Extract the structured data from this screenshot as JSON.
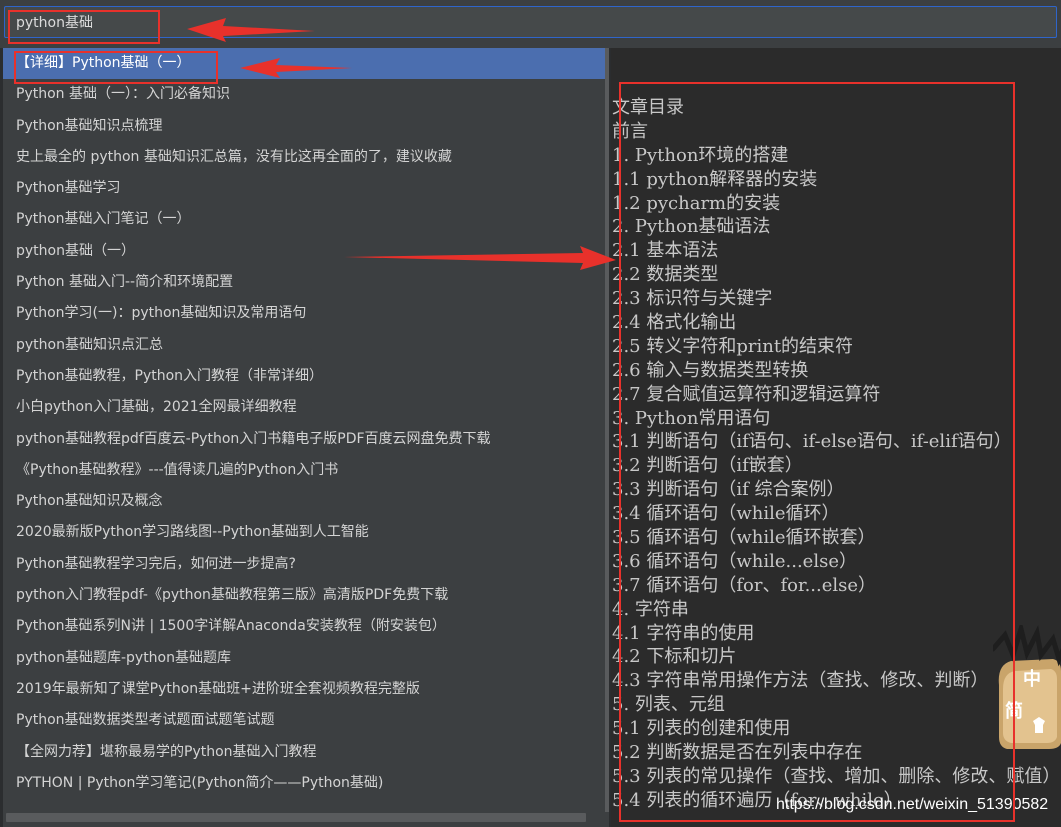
{
  "search": {
    "value": "python基础"
  },
  "results": [
    "【详细】Python基础（一）",
    "Python 基础（一）：入门必备知识",
    "Python基础知识点梳理",
    "史上最全的 python 基础知识汇总篇，没有比这再全面的了，建议收藏",
    "Python基础学习",
    "Python基础入门笔记（一）",
    "python基础（一）",
    "Python 基础入门--简介和环境配置",
    "Python学习(一)：python基础知识及常用语句",
    "python基础知识点汇总",
    "Python基础教程，Python入门教程（非常详细）",
    "小白python入门基础，2021全网最详细教程",
    "python基础教程pdf百度云-Python入门书籍电子版PDF百度云网盘免费下载",
    "《Python基础教程》---值得读几遍的Python入门书",
    "Python基础知识及概念",
    "2020最新版Python学习路线图--Python基础到人工智能",
    "Python基础教程学习完后，如何进一步提高?",
    "python入门教程pdf-《python基础教程第三版》高清版PDF免费下载",
    "Python基础系列N讲 | 1500字详解Anaconda安装教程（附安装包）",
    "python基础题库-python基础题库",
    "2019年最新知了课堂Python基础班+进阶班全套视频教程完整版",
    "Python基础数据类型考试题面试题笔试题",
    "【全网力荐】堪称最易学的Python基础入门教程",
    "PYTHON | Python学习笔记(Python简介——Python基础)"
  ],
  "selected_index": 0,
  "preview": {
    "toc": [
      "文章目录",
      "前言",
      "1. Python环境的搭建",
      "1.1 python解释器的安装",
      "1.2 pycharm的安装",
      "2. Python基础语法",
      "2.1 基本语法",
      "2.2 数据类型",
      "2.3 标识符与关键字",
      "2.4 格式化输出",
      "2.5 转义字符和print的结束符",
      "2.6 输入与数据类型转换",
      "2.7 复合赋值运算符和逻辑运算符",
      "3. Python常用语句",
      "3.1 判断语句（if语句、if-else语句、if-elif语句）",
      "3.2 判断语句（if嵌套）",
      "3.3 判断语句（if 综合案例）",
      "3.4 循环语句（while循环）",
      "3.5 循环语句（while循环嵌套）",
      "3.6 循环语句（while...else）",
      "3.7 循环语句（for、for...else）",
      "4. 字符串",
      "4.1 字符串的使用",
      "4.2 下标和切片",
      "4.3 字符串常用操作方法（查找、修改、判断）",
      "5. 列表、元组",
      "5.1 列表的创建和使用",
      "5.2 判断数据是否在列表中存在",
      "5.3 列表的常见操作（查找、增加、删除、修改、赋值）",
      "5.4 列表的循环遍历（for、while）"
    ]
  },
  "watermark": "https://blog.csdn.net/weixin_51390582",
  "mascot_text": [
    "中",
    "简"
  ],
  "colors": {
    "annotation": "#e8312b",
    "selection": "#4b6eaf",
    "focus_border": "#2f65ca"
  }
}
